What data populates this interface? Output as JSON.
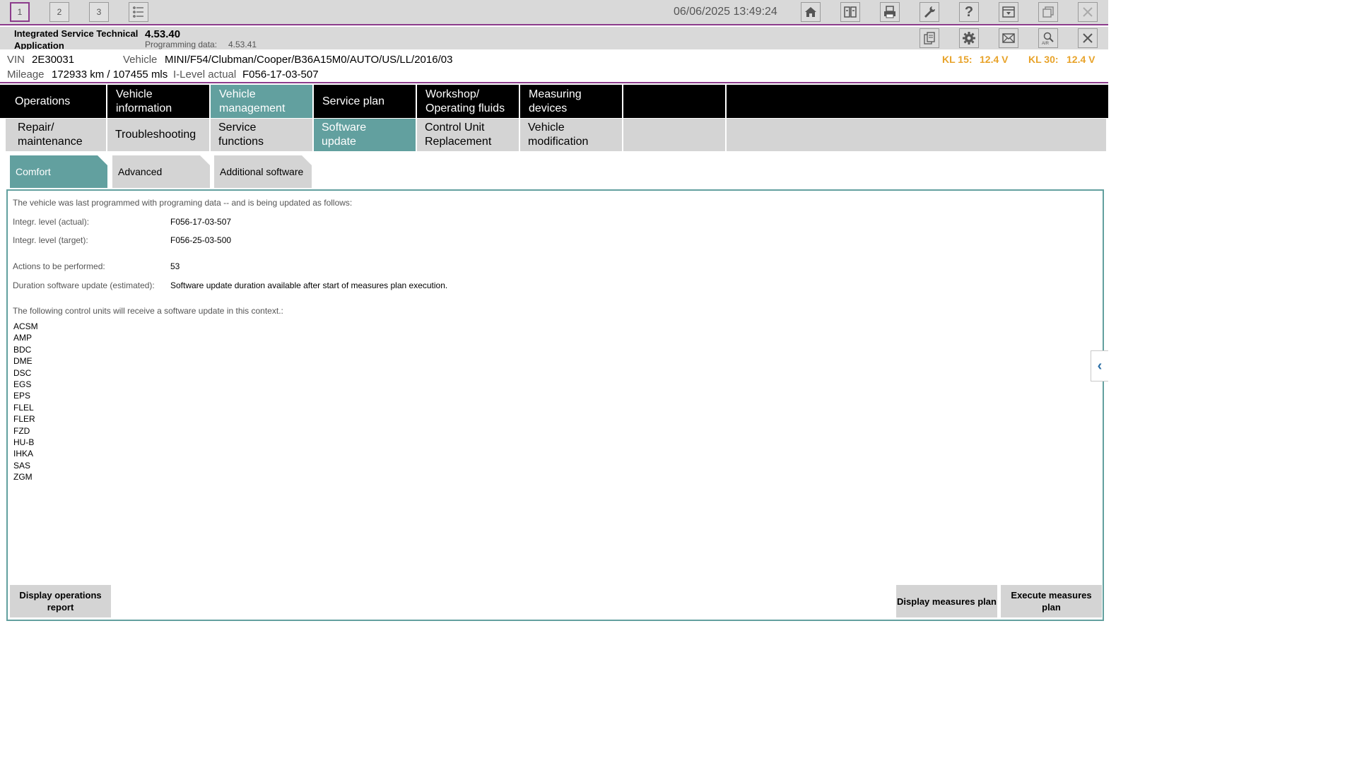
{
  "workspaces": [
    "1",
    "2",
    "3"
  ],
  "datetime": "06/06/2025 13:49:24",
  "toolbar_icons": [
    "home-icon",
    "swap-icon",
    "print-icon",
    "wrench-icon",
    "help-icon",
    "dropdown-icon",
    "restore-window-icon",
    "close-icon"
  ],
  "app": {
    "name": "Integrated Service Technical Application",
    "version": "4.53.40",
    "programming_label": "Programming data:",
    "programming_value": "4.53.41"
  },
  "app_icons": [
    "documents-icon",
    "settings-icon",
    "mail-icon",
    "air-search-icon",
    "close-icon"
  ],
  "vehicle": {
    "vin_label": "VIN",
    "vin": "2E30031",
    "vehicle_label": "Vehicle",
    "vehicle": "MINI/F54/Clubman/Cooper/B36A15M0/AUTO/US/LL/2016/03",
    "mileage_label": "Mileage",
    "mileage": "172933 km / 107455 mls",
    "ilevel_label": "I-Level actual",
    "ilevel": "F056-17-03-507",
    "kl15_label": "KL 15:",
    "kl15": "12.4 V",
    "kl30_label": "KL 30:",
    "kl30": "12.4 V"
  },
  "nav_main": [
    {
      "label": "Operations"
    },
    {
      "label": "Vehicle information"
    },
    {
      "label": "Vehicle management"
    },
    {
      "label": "Service plan"
    },
    {
      "label": "Workshop/ Operating fluids"
    },
    {
      "label": "Measuring devices"
    },
    {
      "label": ""
    },
    {
      "label": ""
    }
  ],
  "nav_sub": [
    {
      "label": "Repair/ maintenance"
    },
    {
      "label": "Troubleshooting"
    },
    {
      "label": "Service functions"
    },
    {
      "label": "Software update"
    },
    {
      "label": "Control Unit Replacement"
    },
    {
      "label": "Vehicle modification"
    },
    {
      "label": ""
    },
    {
      "label": ""
    }
  ],
  "tabs": [
    "Comfort",
    "Advanced",
    "Additional software"
  ],
  "content": {
    "intro": "The vehicle was last programmed with programing data -- and is being updated as follows:",
    "actual_label": "Integr. level (actual):",
    "actual_value": "F056-17-03-507",
    "target_label": "Integr. level (target):",
    "target_value": "F056-25-03-500",
    "actions_label": "Actions to be performed:",
    "actions_value": "53",
    "duration_label": "Duration software update (estimated):",
    "duration_value": "Software update duration available after start of measures plan execution.",
    "units_heading": "The following control units will receive a software update in this context.:",
    "control_units": [
      "ACSM",
      "AMP",
      "BDC",
      "DME",
      "DSC",
      "EGS",
      "EPS",
      "FLEL",
      "FLER",
      "FZD",
      "HU-B",
      "IHKA",
      "SAS",
      "ZGM"
    ]
  },
  "buttons": {
    "operations_report": "Display operations report",
    "display_plan": "Display measures plan",
    "execute_plan": "Execute measures plan"
  },
  "colors": {
    "accent_teal": "#62a09f",
    "border_purple": "#8c3c8c",
    "voltage_orange": "#e8a32a"
  }
}
